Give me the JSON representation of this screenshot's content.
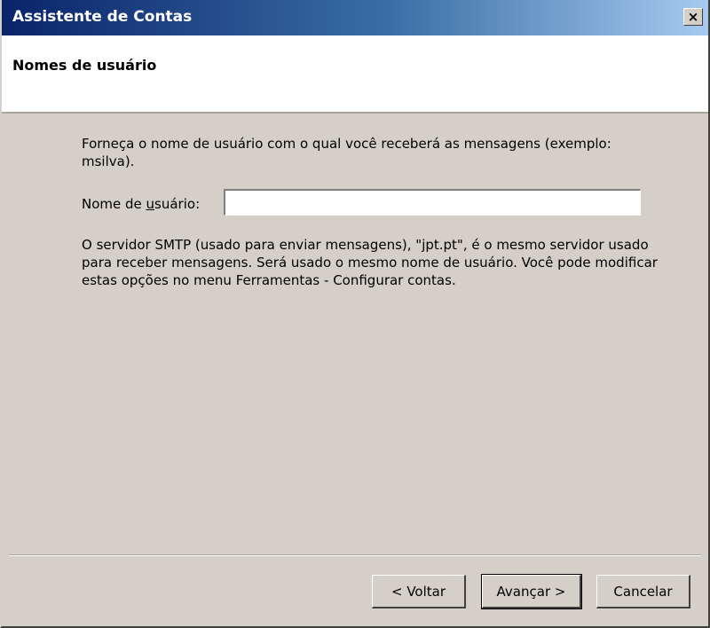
{
  "window": {
    "title": "Assistente de Contas",
    "close_glyph": "×"
  },
  "header": {
    "title": "Nomes de usuário"
  },
  "content": {
    "instruction": "Forneça o nome de usuário com o qual você receberá as mensagens (exemplo: msilva).",
    "username_label_prefix": "Nome de ",
    "username_label_mnemonic": "u",
    "username_label_suffix": "suário:",
    "username_value": "",
    "smtp_note": "O servidor SMTP (usado para enviar mensagens), \"jpt.pt\", é o mesmo servidor usado para receber mensagens. Será usado o mesmo nome de usuário. Você pode modificar estas opções no menu Ferramentas - Configurar contas."
  },
  "buttons": {
    "back": "< Voltar",
    "next": "Avançar >",
    "cancel": "Cancelar"
  }
}
